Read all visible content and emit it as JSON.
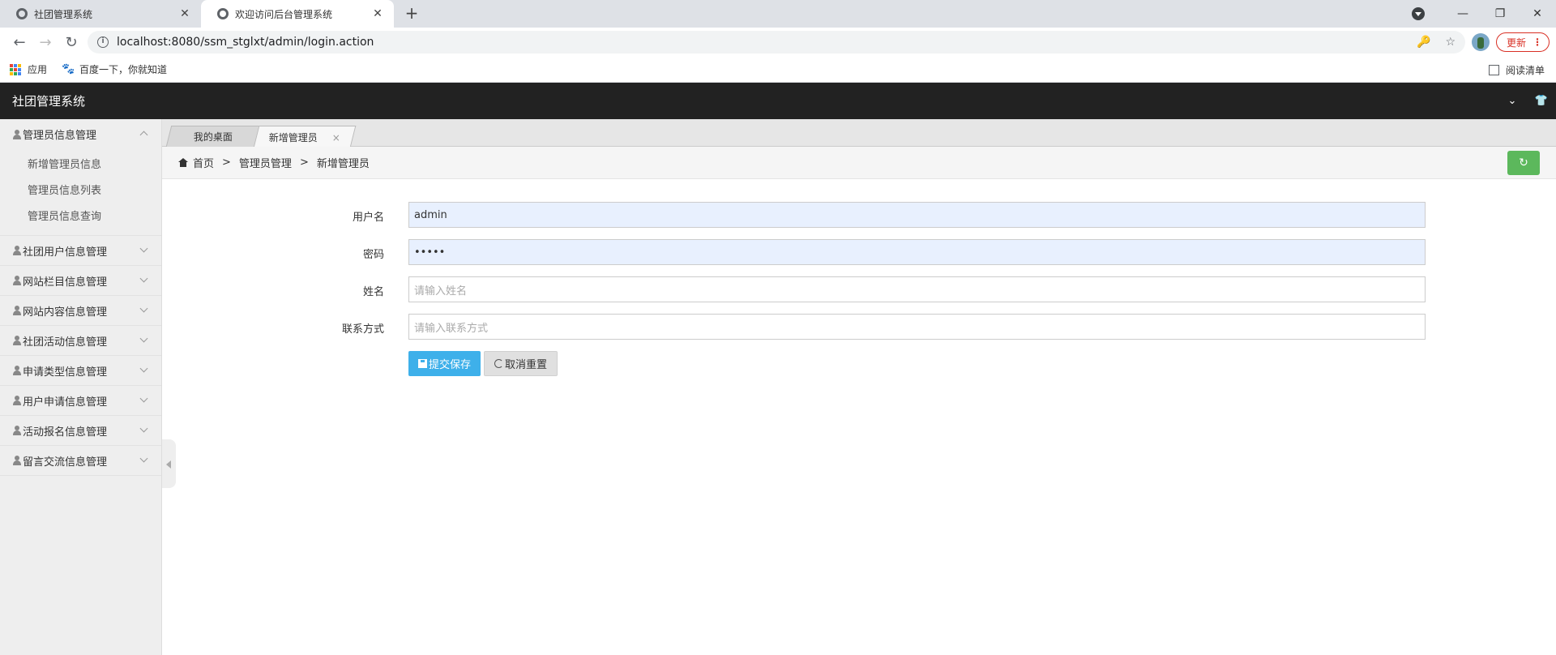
{
  "browser": {
    "tabs": [
      {
        "title": "社团管理系统",
        "close": "✕"
      },
      {
        "title": "欢迎访问后台管理系统",
        "close": "✕"
      }
    ],
    "new_tab": "+",
    "window_controls": {
      "minimize": "—",
      "restore": "❐",
      "close": "✕"
    },
    "url": "localhost:8080/ssm_stglxt/admin/login.action",
    "update_label": "更新",
    "update_dots": "⋮",
    "bookmarks": [
      {
        "label": "应用",
        "icon": "apps-grid-icon"
      },
      {
        "label": "百度一下，你就知道",
        "icon": "baidu-paw-icon"
      }
    ],
    "reading_list": "阅读清单",
    "nav": {
      "back": "←",
      "forward": "→",
      "reload": "↻"
    },
    "omnibox_icons": {
      "key": "🔑",
      "star": "☆",
      "info": "i"
    }
  },
  "app": {
    "title": "社团管理系统",
    "header_icons": {
      "dropdown": "⌄",
      "theme": "👕"
    }
  },
  "sidebar": {
    "groups": [
      {
        "label": "管理员信息管理",
        "open": true,
        "items": [
          "新增管理员信息",
          "管理员信息列表",
          "管理员信息查询"
        ]
      },
      {
        "label": "社团用户信息管理",
        "open": false
      },
      {
        "label": "网站栏目信息管理",
        "open": false
      },
      {
        "label": "网站内容信息管理",
        "open": false
      },
      {
        "label": "社团活动信息管理",
        "open": false
      },
      {
        "label": "申请类型信息管理",
        "open": false
      },
      {
        "label": "用户申请信息管理",
        "open": false
      },
      {
        "label": "活动报名信息管理",
        "open": false
      },
      {
        "label": "留言交流信息管理",
        "open": false
      }
    ]
  },
  "page_tabs": [
    {
      "label": "我的桌面"
    },
    {
      "label": "新增管理员",
      "close": "×"
    }
  ],
  "breadcrumb": {
    "home": "首页",
    "sep": ">",
    "level1": "管理员管理",
    "level2": "新增管理员",
    "refresh_icon": "↻"
  },
  "form": {
    "username": {
      "label": "用户名",
      "value": "admin"
    },
    "password": {
      "label": "密码",
      "value": "•••••"
    },
    "name": {
      "label": "姓名",
      "placeholder": "请输入姓名"
    },
    "contact": {
      "label": "联系方式",
      "placeholder": "请输入联系方式"
    },
    "save_label": "提交保存",
    "reset_label": "取消重置"
  },
  "colors": {
    "header_bg": "#222222",
    "save_button": "#3eb0ea",
    "refresh_button": "#5cb85c",
    "autofill_bg": "#e8f0fe"
  }
}
